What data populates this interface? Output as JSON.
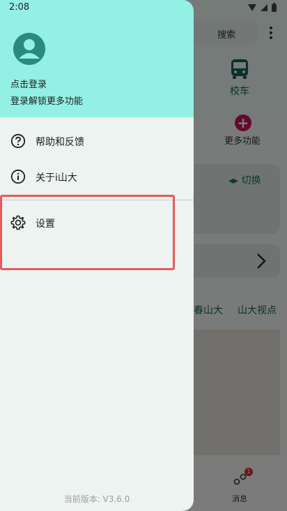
{
  "status_bar": {
    "time": "2:08"
  },
  "background": {
    "search_label": "搜索",
    "bus_label": "校车",
    "more_functions_label": "更多功能",
    "switch_label": "切换",
    "tabs": [
      "春山大",
      "山大视点"
    ],
    "messages_label": "消息",
    "messages_badge": "1"
  },
  "drawer": {
    "login_title": "点击登录",
    "login_subtitle": "登录解锁更多功能",
    "menu": [
      {
        "label": "帮助和反馈",
        "icon": "help-circle-icon"
      },
      {
        "label": "关于i山大",
        "icon": "info-icon"
      },
      {
        "label": "设置",
        "icon": "gear-icon"
      }
    ],
    "version": "当前版本: V3.6.0"
  },
  "colors": {
    "drawer_header": "#93f0e5",
    "drawer_body": "#ecf3f0",
    "highlight": "#e85a5a",
    "accent": "#1a5d57"
  }
}
